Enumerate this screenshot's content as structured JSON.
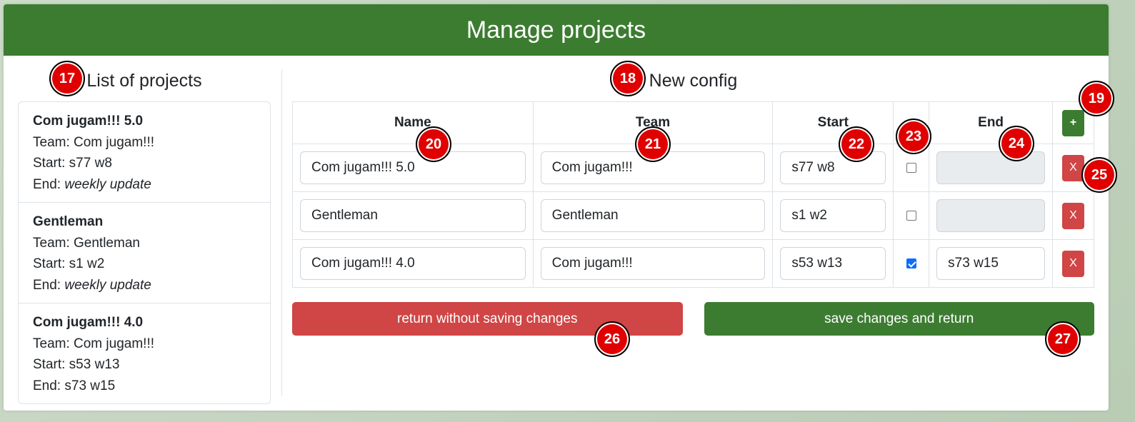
{
  "header": {
    "title": "Manage projects"
  },
  "left": {
    "title": "List of projects",
    "projects": [
      {
        "name": "Com jugam!!! 5.0",
        "team_label": "Team: Com jugam!!!",
        "start_label": "Start: s77 w8",
        "end_prefix": "End: ",
        "end_value": "weekly update"
      },
      {
        "name": "Gentleman",
        "team_label": "Team: Gentleman",
        "start_label": "Start: s1 w2",
        "end_prefix": "End: ",
        "end_value": "weekly update"
      },
      {
        "name": "Com jugam!!! 4.0",
        "team_label": "Team: Com jugam!!!",
        "start_label": "Start: s53 w13",
        "end_prefix": "End: ",
        "end_value": "s73 w15"
      }
    ]
  },
  "right": {
    "title": "New config",
    "columns": {
      "name": "Name",
      "team": "Team",
      "start": "Start",
      "end": "End"
    },
    "add_label": "+",
    "remove_label": "X",
    "rows": [
      {
        "name": "Com jugam!!! 5.0",
        "team": "Com jugam!!!",
        "start": "s77 w8",
        "checked": false,
        "end": ""
      },
      {
        "name": "Gentleman",
        "team": "Gentleman",
        "start": "s1 w2",
        "checked": false,
        "end": ""
      },
      {
        "name": "Com jugam!!! 4.0",
        "team": "Com jugam!!!",
        "start": "s53 w13",
        "checked": true,
        "end": "s73 w15"
      }
    ],
    "cancel_label": "return without saving changes",
    "save_label": "save changes and return"
  },
  "markers": [
    "17",
    "18",
    "19",
    "20",
    "21",
    "22",
    "23",
    "24",
    "25",
    "26",
    "27"
  ],
  "colors": {
    "header": "#3c7c31",
    "danger": "#d04545",
    "success": "#3c7c31",
    "marker": "#e00000"
  }
}
